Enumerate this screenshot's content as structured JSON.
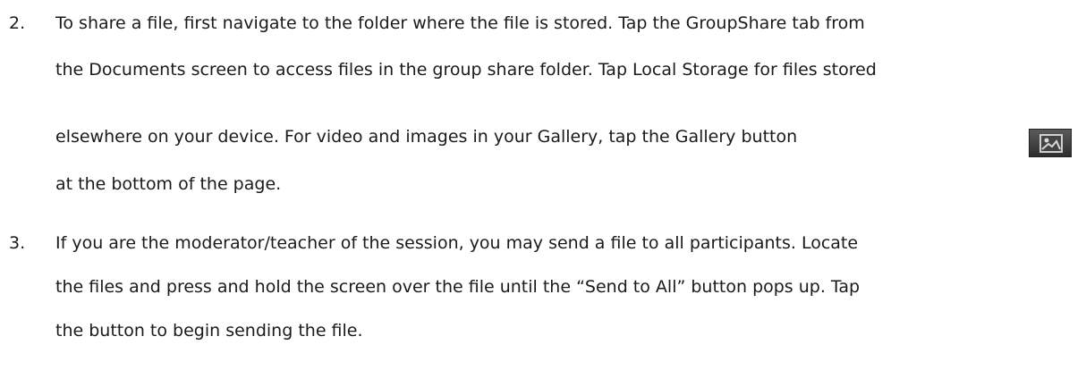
{
  "item2": {
    "number": "2.",
    "lines": [
      "To share a file, first navigate to the folder where the file is stored. Tap the GroupShare tab from",
      "the Documents screen to access files in the group share folder. Tap Local Storage for files stored",
      "elsewhere on your device. For video and images in your Gallery, tap the Gallery button",
      "at the bottom of the page."
    ],
    "inline_icon": "gallery-icon"
  },
  "item3": {
    "number": "3.",
    "lines": [
      "If you are the moderator/teacher of the session, you may send a file to all participants. Locate",
      "the files and press and hold the screen over the file until the “Send to All” button pops up. Tap",
      "the button to begin sending the file."
    ]
  }
}
